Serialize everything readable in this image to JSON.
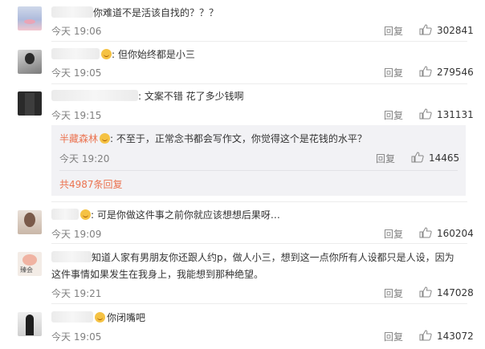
{
  "reply_label": "回复",
  "comments": [
    {
      "text": "你难道不是活该自找的？？？",
      "time": "今天 19:06",
      "likes": "302841"
    },
    {
      "text": ": 但你始终都是小三",
      "time": "今天 19:05",
      "likes": "279546"
    },
    {
      "text": ": 文案不错 花了多少钱啊",
      "time": "今天 19:15",
      "likes": "131131",
      "reply": {
        "user": "半藏森林",
        "text": ": 不至于，正常念书都会写作文，你觉得这个是花钱的水平？",
        "time": "今天 19:20",
        "likes": "14465",
        "more": "共4987条回复"
      }
    },
    {
      "text": ": 可是你做这件事之前你就应该想想后果呀…",
      "time": "今天 19:09",
      "likes": "160204"
    },
    {
      "text_line1": "知道人家有男朋友你还跟人约p，做人小三，想到这一点你所有人设都只是人设，因为",
      "text_line2": "这件事情如果发生在我身上，我能想到那种绝望。",
      "avatar_caption": "臻会",
      "time": "今天 19:21",
      "likes": "147028"
    },
    {
      "text": "你闭嘴吧",
      "time": "今天 19:05",
      "likes": "143072"
    }
  ],
  "icons": {
    "like": "thumbs-up-icon",
    "emoji": "smile-emoji-icon"
  },
  "colors": {
    "accent": "#eb7350",
    "meta": "#808080",
    "reply_bg": "#f2f2f5"
  }
}
